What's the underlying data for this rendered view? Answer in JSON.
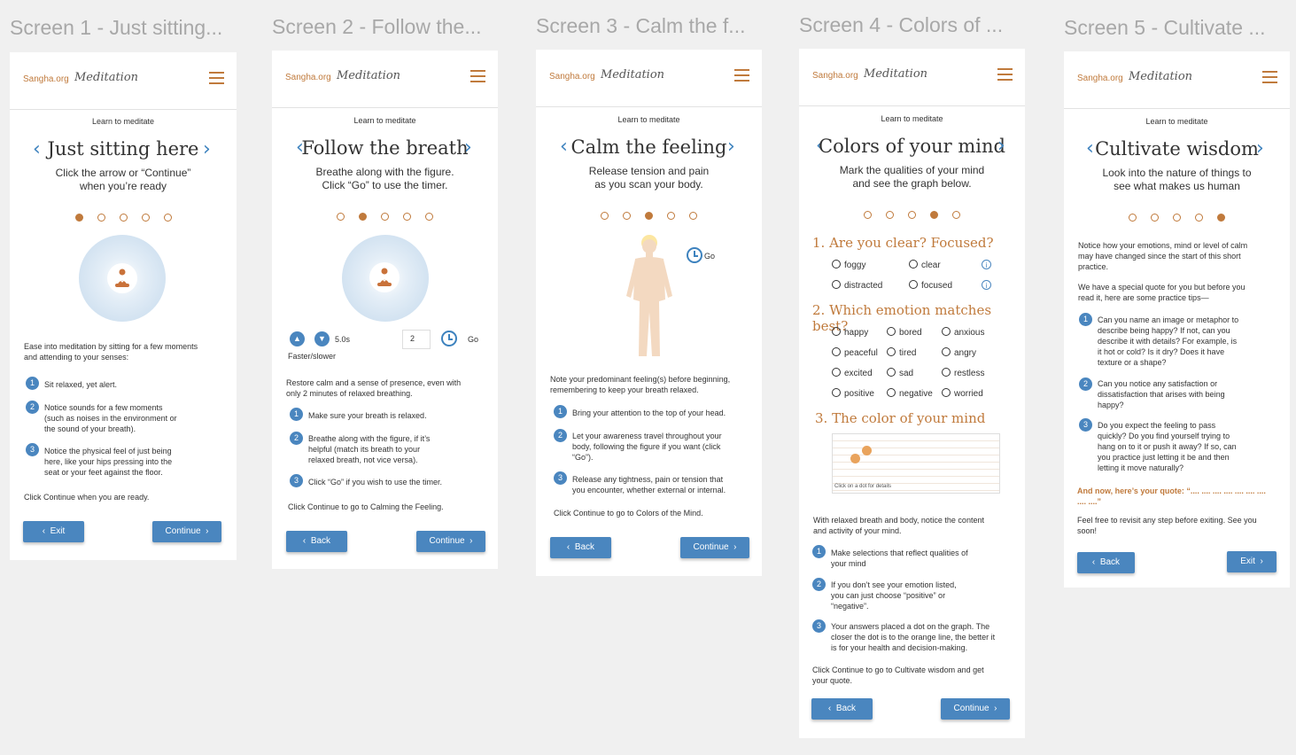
{
  "frames": [
    {
      "title": "Screen 1 - Just sitting...",
      "header": {
        "brand": "Sangha.org",
        "app": "Meditation"
      },
      "learn": "Learn to meditate",
      "heading": "Just sitting here",
      "sub1": "Click the arrow or “Continue”",
      "sub2": "when you’re ready",
      "intro1": "Ease into meditation by sitting for a few moments",
      "intro2": "and attending to your senses:",
      "steps": [
        {
          "n": "1",
          "lines": [
            "Sit relaxed, yet alert."
          ]
        },
        {
          "n": "2",
          "lines": [
            "Notice sounds for a few moments",
            "(such as noises in the environment or",
            "the sound of your breath)."
          ]
        },
        {
          "n": "3",
          "lines": [
            "Notice the physical feel of just being",
            "here, like your hips pressing into the",
            "seat or your feet against the floor."
          ]
        }
      ],
      "footer": "Click Continue when you are ready.",
      "left_btn": "Exit",
      "right_btn": "Continue"
    },
    {
      "title": "Screen 2 - Follow the...",
      "header": {
        "brand": "Sangha.org",
        "app": "Meditation"
      },
      "learn": "Learn to meditate",
      "heading": "Follow the breath",
      "sub1": "Breathe along with the figure.",
      "sub2": "Click “Go” to use the timer.",
      "speed": "5.0s",
      "speed_label": "Faster/slower",
      "timer_value": "2",
      "go": "Go",
      "intro1": "Restore calm and a sense of presence, even with",
      "intro2": "only 2 minutes of relaxed breathing.",
      "steps": [
        {
          "n": "1",
          "lines": [
            "Make sure your breath is relaxed."
          ]
        },
        {
          "n": "2",
          "lines": [
            "Breathe along with the figure, if it’s",
            "helpful (match its breath to your",
            "relaxed breath, not vice versa)."
          ]
        },
        {
          "n": "3",
          "lines": [
            "Click “Go” if you wish to use the timer."
          ]
        }
      ],
      "footer": "Click Continue to go to Calming the Feeling.",
      "left_btn": "Back",
      "right_btn": "Continue"
    },
    {
      "title": "Screen 3 - Calm the f...",
      "header": {
        "brand": "Sangha.org",
        "app": "Meditation"
      },
      "learn": "Learn to meditate",
      "heading": "Calm the feeling",
      "sub1": "Release tension and pain",
      "sub2": "as you scan your body.",
      "go": "Go",
      "intro1": "Note your predominant feeling(s) before beginning,",
      "intro2": "remembering to keep your breath relaxed.",
      "steps": [
        {
          "n": "1",
          "lines": [
            "Bring your attention to the top of your head."
          ]
        },
        {
          "n": "2",
          "lines": [
            "Let your awareness travel throughout your",
            "body, following the figure if you want (click",
            "“Go”)."
          ]
        },
        {
          "n": "3",
          "lines": [
            "Release any tightness, pain or tension that",
            "you encounter, whether external or internal."
          ]
        }
      ],
      "footer": "Click Continue to go to Colors of the Mind.",
      "left_btn": "Back",
      "right_btn": "Continue"
    },
    {
      "title": "Screen 4 - Colors of ...",
      "header": {
        "brand": "Sangha.org",
        "app": "Meditation"
      },
      "learn": "Learn to meditate",
      "heading": "Colors of your mind",
      "sub1": "Mark the qualities of your mind",
      "sub2": "and see the graph below.",
      "q1": "1. Are you clear? Focused?",
      "q1_opts": [
        "foggy",
        "clear",
        "distracted",
        "focused"
      ],
      "q2": "2. Which emotion matches best?",
      "q2_opts": [
        "happy",
        "bored",
        "anxious",
        "peaceful",
        "tired",
        "angry",
        "excited",
        "sad",
        "restless",
        "positive",
        "negative",
        "worried"
      ],
      "q3": "3. The color of your mind",
      "graph_hint": "Click on a dot for details",
      "intro1": "With relaxed breath and body, notice the content",
      "intro2": "and activity of your mind.",
      "steps": [
        {
          "n": "1",
          "lines": [
            "Make selections that reflect qualities of",
            "your mind"
          ]
        },
        {
          "n": "2",
          "lines": [
            "If you don’t see your emotion listed,",
            "you can just choose “positive” or",
            "“negative”."
          ]
        },
        {
          "n": "3",
          "lines": [
            "Your answers placed a dot on the graph. The",
            "closer the dot is to the orange line, the better it",
            "is for your health and decision-making."
          ]
        }
      ],
      "footer1": "Click Continue to go to Cultivate wisdom and get",
      "footer2": "your quote.",
      "left_btn": "Back",
      "right_btn": "Continue"
    },
    {
      "title": "Screen 5 - Cultivate ...",
      "header": {
        "brand": "Sangha.org",
        "app": "Meditation"
      },
      "learn": "Learn to meditate",
      "heading": "Cultivate wisdom",
      "sub1": "Look into the nature of things to",
      "sub2": "see what makes us human",
      "intro": [
        "Notice how your emotions, mind or level of calm",
        "may have changed since the start of this short",
        "practice."
      ],
      "intro_b": [
        "We have a special quote for you but before you",
        "read it, here are some practice tips—"
      ],
      "steps": [
        {
          "n": "1",
          "lines": [
            "Can you name an image or metaphor to",
            "describe being happy? If not, can you",
            "describe it with details? For example, is",
            "it hot or cold? Is it dry? Does it have",
            "texture or a shape?"
          ]
        },
        {
          "n": "2",
          "lines": [
            "Can you notice any satisfaction or",
            "dissatisfaction that arises with being",
            "happy?"
          ]
        },
        {
          "n": "3",
          "lines": [
            "Do you expect the feeling to pass",
            "quickly? Do you find yourself trying to",
            "hang on to it or push it away? If so, can",
            "you practice just letting it be and then",
            "letting it move naturally?"
          ]
        }
      ],
      "quote1": "And now, here’s your quote: “.... .... .... .... .... .... ....",
      "quote2": ".... ....”",
      "footer1": "Feel free to revisit any step before exiting. See you",
      "footer2": "soon!",
      "left_btn": "Back",
      "right_btn": "Exit"
    }
  ]
}
